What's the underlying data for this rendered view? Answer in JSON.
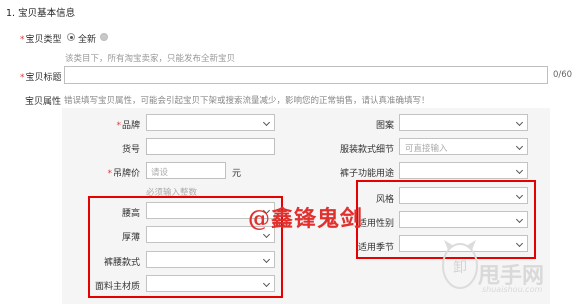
{
  "section_title": "1. 宝贝基本信息",
  "item_type": {
    "label": "宝贝类型",
    "option_new": "全新",
    "hint": "该类目下，所有淘宝卖家，只能发布全新宝贝"
  },
  "item_title": {
    "label": "宝贝标题",
    "value": "",
    "counter": "0/60"
  },
  "attributes": {
    "label": "宝贝属性",
    "hint": "错误填写宝贝属性，可能会引起宝贝下架或搜索流量减少，影响您的正常销售，请认真准确填写！",
    "brand_label": "品牌",
    "pattern_label": "图案",
    "item_no_label": "货号",
    "clothing_style_detail_label": "服装款式细节",
    "clothing_style_detail_placeholder": "可直接输入",
    "price_label": "吊牌价",
    "price_placeholder": "请设",
    "price_unit": "元",
    "price_hint": "必须输入整数",
    "pants_function_label": "裤子功能用途",
    "waist_label": "腰高",
    "thickness_label": "厚薄",
    "style_label": "风格",
    "gender_label": "适用性别",
    "pants_cut_label": "裤腰款式",
    "season_label": "适用季节",
    "fabric_label": "面料主材质"
  },
  "watermark_text": "@鑫锋鬼剑",
  "site_logo": {
    "name": "甩手网",
    "url_text": "shuaishou.com"
  },
  "colors": {
    "required_star": "#e4393c",
    "annotation_red": "#e60000",
    "panel_bg": "#f5f5f5"
  }
}
